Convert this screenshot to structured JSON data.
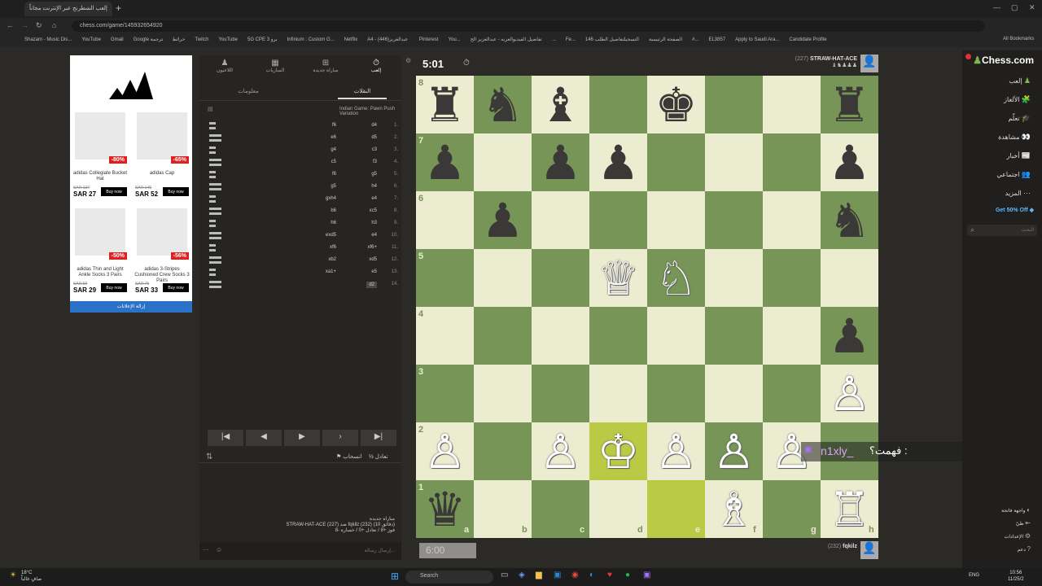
{
  "browser": {
    "tab_title": "إلعب الشطرنج عبر الإنترنت مجاناً",
    "url": "chess.com/game/145932654920",
    "bookmarks": [
      "Shazam - Music Dis...",
      "YouTube",
      "Gmail",
      "Google خرائط",
      "ترجمة",
      "Twitch",
      "YouTube",
      "5G CPE 3 برو",
      "Infinium : Custom G...",
      "Netflix",
      "A4 - عبدالعزيز",
      "(446) Pinterest",
      "You...",
      "تفاصيل الفيديو",
      "العزيه - عبدالعزيز الج...",
      "Fe...",
      "الصفحة الرئيسية",
      "التسجيل",
      "تفاصيل الطلب 146#...",
      "EL3857",
      "Apply to Saudi Ara...",
      "Candidate Profile"
    ],
    "all_bookmarks": "All Bookmarks"
  },
  "ad": {
    "items": [
      {
        "name": "adidas Collegiate Bucket Hat",
        "badge": "-80%",
        "old": "SAR 137",
        "price": "SAR 27",
        "btn": "Buy now"
      },
      {
        "name": "adidas Cap",
        "badge": "-65%",
        "old": "SAR 149",
        "price": "SAR 52",
        "btn": "Buy now"
      },
      {
        "name": "adidas Thin and Light Ankle Socks 3 Pairs",
        "badge": "-50%",
        "old": "SAR 59",
        "price": "SAR 29",
        "btn": "Buy now"
      },
      {
        "name": "adidas 3-Stripes Cushioned Crew Socks 3 Pairs",
        "badge": "-56%",
        "old": "SAR 75",
        "price": "SAR 33",
        "btn": "Buy now"
      }
    ],
    "footer": "إزالة الإعلانات"
  },
  "panel": {
    "tabs": [
      "إلعب",
      "مباراة جديدة",
      "المباريات",
      "اللاعبون"
    ],
    "subtabs": [
      "النقلات",
      "معلومات"
    ],
    "opening": "Indian Game: Pawn Push Variation",
    "moves": [
      {
        "n": "1.",
        "w": "d4",
        "b": "f6"
      },
      {
        "n": "2.",
        "w": "d5",
        "b": "e6"
      },
      {
        "n": "3.",
        "w": "c3",
        "b": "g4"
      },
      {
        "n": "4.",
        "w": "f3",
        "b": "c5"
      },
      {
        "n": "5.",
        "w": "g5",
        "b": "f6"
      },
      {
        "n": "6.",
        "w": "h4",
        "b": "g5"
      },
      {
        "n": "7.",
        "w": "e4",
        "b": "gxh4"
      },
      {
        "n": "8.",
        "w": "xc5",
        "b": "b6"
      },
      {
        "n": "9.",
        "w": "h3",
        "b": "h6"
      },
      {
        "n": "10.",
        "w": "e4",
        "b": "exd5"
      },
      {
        "n": "11.",
        "w": "xf6+",
        "b": "xf6"
      },
      {
        "n": "12.",
        "w": "xd5",
        "b": "xb2"
      },
      {
        "n": "13.",
        "w": "e5",
        "b": "xa1+"
      },
      {
        "n": "14.",
        "w": "d2",
        "b": ""
      }
    ],
    "draw": "تعادل",
    "resign": "انسحاب",
    "new_game": "مباراة جديدة",
    "game_line": "STRAW-HAT-ACE (227) ضد fqkilz (232) (10 دقائق)",
    "result_line": "فوز +8 / تعادل +0 / خسارة -8",
    "chat_placeholder": "إرسال رسالة..."
  },
  "game": {
    "top_clock": "5:01",
    "top_player": "STRAW-HAT-ACE",
    "top_rating": "(227)",
    "bottom_clock": "6:00",
    "bottom_player": "fqkilz",
    "bottom_rating": "(232)"
  },
  "board": {
    "ranks": [
      "8",
      "7",
      "6",
      "5",
      "4",
      "3",
      "2",
      "1"
    ],
    "files": [
      "a",
      "b",
      "c",
      "d",
      "e",
      "f",
      "g",
      "h"
    ],
    "pieces": [
      {
        "sq": "a8",
        "p": "♜",
        "c": "b"
      },
      {
        "sq": "b8",
        "p": "♞",
        "c": "b"
      },
      {
        "sq": "c8",
        "p": "♝",
        "c": "b"
      },
      {
        "sq": "e8",
        "p": "♚",
        "c": "b"
      },
      {
        "sq": "h8",
        "p": "♜",
        "c": "b"
      },
      {
        "sq": "a7",
        "p": "♟",
        "c": "b"
      },
      {
        "sq": "c7",
        "p": "♟",
        "c": "b"
      },
      {
        "sq": "d7",
        "p": "♟",
        "c": "b"
      },
      {
        "sq": "h7",
        "p": "♟",
        "c": "b"
      },
      {
        "sq": "b6",
        "p": "♟",
        "c": "b"
      },
      {
        "sq": "h6",
        "p": "♞",
        "c": "b"
      },
      {
        "sq": "d5",
        "p": "♕",
        "c": "w"
      },
      {
        "sq": "e5",
        "p": "♘",
        "c": "w"
      },
      {
        "sq": "h4",
        "p": "♟",
        "c": "b"
      },
      {
        "sq": "h3",
        "p": "♙",
        "c": "w"
      },
      {
        "sq": "a2",
        "p": "♙",
        "c": "w"
      },
      {
        "sq": "c2",
        "p": "♙",
        "c": "w"
      },
      {
        "sq": "d2",
        "p": "♔",
        "c": "w"
      },
      {
        "sq": "e2",
        "p": "♙",
        "c": "w"
      },
      {
        "sq": "f2",
        "p": "♙",
        "c": "w"
      },
      {
        "sq": "g2",
        "p": "♙",
        "c": "w"
      },
      {
        "sq": "a1",
        "p": "♛",
        "c": "b"
      },
      {
        "sq": "f1",
        "p": "♗",
        "c": "w"
      },
      {
        "sq": "h1",
        "p": "♖",
        "c": "w"
      }
    ],
    "highlight": [
      "d2",
      "e1"
    ]
  },
  "overlay": {
    "chat_user": "n1xly_",
    "chat_text": "فهمت؟ :"
  },
  "sidebar": {
    "logo": "Chess.com",
    "items": [
      "إلعب",
      "الألغاز",
      "تعلّم",
      "مشاهدة",
      "أخبار",
      "اجتماعي",
      "المزيد"
    ],
    "promo": "Get 50% Off",
    "search_placeholder": "البحث",
    "bottom": [
      "واجهة فاتحة",
      "طيّ",
      "الإعدادات",
      "دعم"
    ]
  },
  "taskbar": {
    "weather": "18°C",
    "weather_sub": "صافٍ غالباً",
    "search": "Search",
    "lang": "ENG",
    "time": "10:56",
    "date": "11/25/2"
  }
}
